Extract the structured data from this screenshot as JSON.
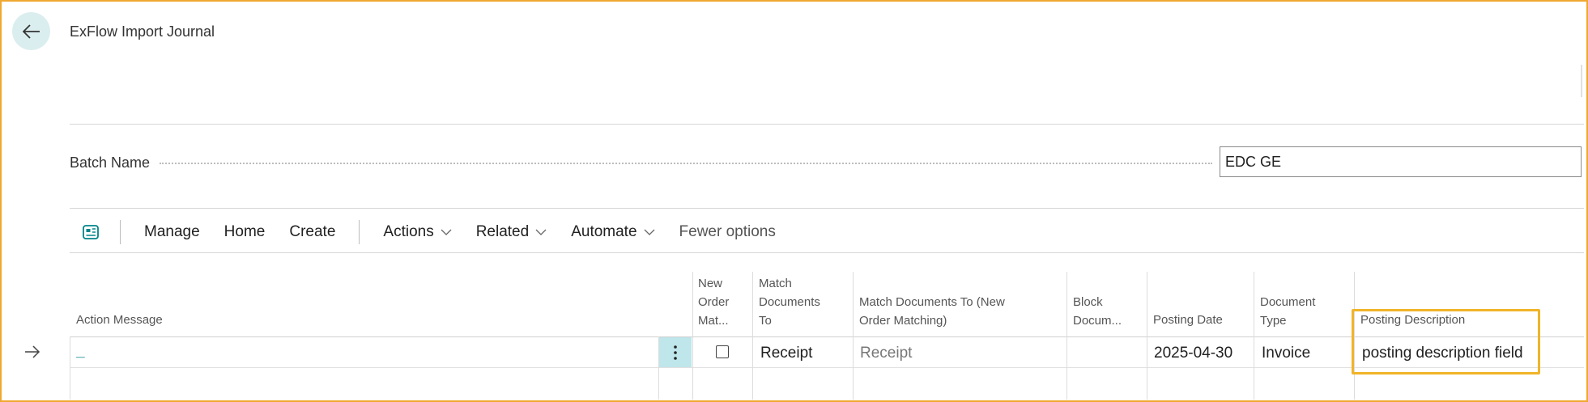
{
  "page": {
    "title": "ExFlow Import Journal"
  },
  "batch": {
    "label": "Batch Name",
    "value": "EDC GE"
  },
  "toolbar": {
    "items": [
      {
        "label": "Manage"
      },
      {
        "label": "Home"
      },
      {
        "label": "Create"
      }
    ],
    "dropdowns": [
      {
        "label": "Actions"
      },
      {
        "label": "Related"
      },
      {
        "label": "Automate"
      }
    ],
    "fewer_options": "Fewer options"
  },
  "grid": {
    "columns": {
      "action_message": "Action Message",
      "new_order_match": [
        "New",
        "Order",
        "Mat..."
      ],
      "match_docs_to": [
        "Match",
        "Documents",
        "To"
      ],
      "match_docs_new": [
        "Match Documents To (New",
        "Order Matching)"
      ],
      "block_docs": [
        "Block",
        "Docum..."
      ],
      "posting_date": "Posting Date",
      "document_type": [
        "Document",
        "Type"
      ],
      "posting_description": "Posting Description"
    },
    "rows": [
      {
        "action_message": "_",
        "new_order_matching": false,
        "match_documents_to": "Receipt",
        "match_documents_to_new": "Receipt",
        "block_documents": "",
        "posting_date": "2025-04-30",
        "document_type": "Invoice",
        "posting_description": "posting description field"
      }
    ]
  },
  "icons": {
    "back": "arrow-left-icon",
    "page_view": "page-view-icon",
    "row_indicator": "arrow-right-icon",
    "row_menu": "vertical-ellipsis-icon",
    "dropdown": "chevron-down-icon"
  },
  "colors": {
    "highlight_border": "#f0b429",
    "frame_border": "#f0a830",
    "accent_teal": "#008489",
    "selected_cell": "#bfe6ea",
    "back_button_bg": "#dbeeef"
  }
}
